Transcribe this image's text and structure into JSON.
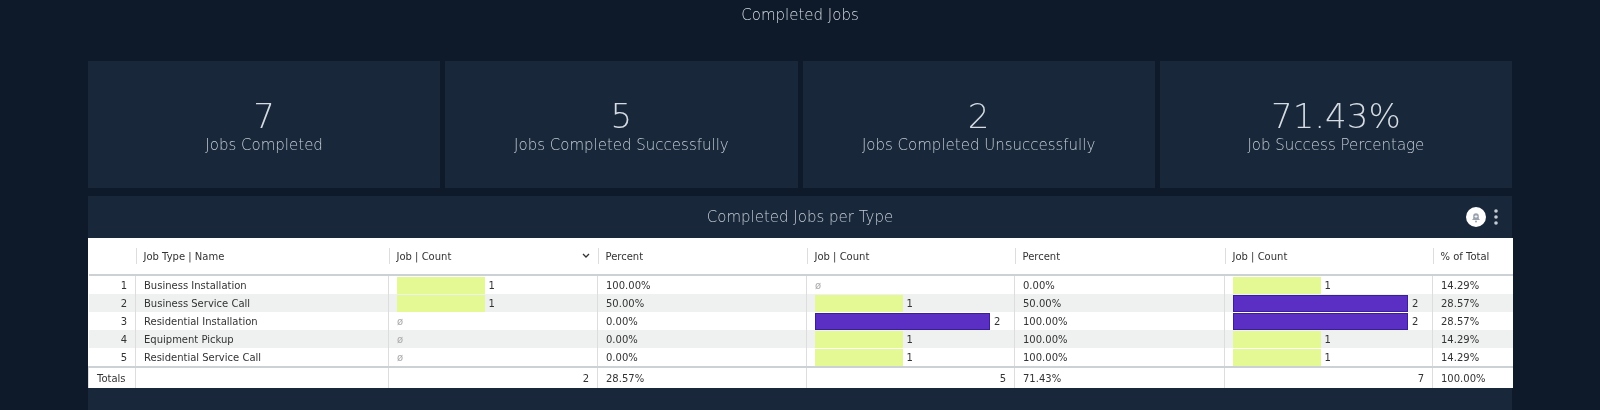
{
  "title": "Completed Jobs",
  "kpis": [
    {
      "value": "7",
      "label": "Jobs Completed"
    },
    {
      "value": "5",
      "label": "Jobs Completed Successfully"
    },
    {
      "value": "2",
      "label": "Jobs Completed Unsuccessfully"
    },
    {
      "value": "71.43%",
      "label": "Job Success Percentage"
    }
  ],
  "table_panel": {
    "title": "Completed Jobs per Type",
    "columns": [
      {
        "label": "Job Type | Name",
        "kind": "text",
        "sort_menu": false
      },
      {
        "label": "Job | Count",
        "kind": "bar",
        "sort_menu": true
      },
      {
        "label": "Percent",
        "kind": "text",
        "sort_menu": false
      },
      {
        "label": "Job | Count",
        "kind": "bar",
        "sort_menu": false
      },
      {
        "label": "Percent",
        "kind": "text",
        "sort_menu": false
      },
      {
        "label": "Job | Count",
        "kind": "bar",
        "sort_menu": false
      },
      {
        "label": "% of Total",
        "kind": "text",
        "sort_menu": false
      }
    ],
    "rows": [
      {
        "index": "1",
        "cells": [
          {
            "text": "Business Installation"
          },
          {
            "text": "1",
            "color": "#e4f993"
          },
          {
            "text": "100.00%"
          },
          {
            "text": "ø"
          },
          {
            "text": "0.00%"
          },
          {
            "text": "1",
            "color": "#e4f993"
          },
          {
            "text": "14.29%"
          }
        ]
      },
      {
        "index": "2",
        "cells": [
          {
            "text": "Business Service Call"
          },
          {
            "text": "1",
            "color": "#e4f993"
          },
          {
            "text": "50.00%"
          },
          {
            "text": "1",
            "color": "#e4f993"
          },
          {
            "text": "50.00%"
          },
          {
            "text": "2",
            "color": "#5b2fc4"
          },
          {
            "text": "28.57%"
          }
        ]
      },
      {
        "index": "3",
        "cells": [
          {
            "text": "Residential Installation"
          },
          {
            "text": "ø"
          },
          {
            "text": "0.00%"
          },
          {
            "text": "2",
            "color": "#5b2fc4"
          },
          {
            "text": "100.00%"
          },
          {
            "text": "2",
            "color": "#5b2fc4"
          },
          {
            "text": "28.57%"
          }
        ]
      },
      {
        "index": "4",
        "cells": [
          {
            "text": "Equipment Pickup"
          },
          {
            "text": "ø"
          },
          {
            "text": "0.00%"
          },
          {
            "text": "1",
            "color": "#e4f993"
          },
          {
            "text": "100.00%"
          },
          {
            "text": "1",
            "color": "#e4f993"
          },
          {
            "text": "14.29%"
          }
        ]
      },
      {
        "index": "5",
        "cells": [
          {
            "text": "Residential Service Call"
          },
          {
            "text": "ø"
          },
          {
            "text": "0.00%"
          },
          {
            "text": "1",
            "color": "#e4f993"
          },
          {
            "text": "100.00%"
          },
          {
            "text": "1",
            "color": "#e4f993"
          },
          {
            "text": "14.29%"
          }
        ]
      }
    ],
    "totals": {
      "label": "Totals",
      "cells": [
        "",
        "2",
        "28.57%",
        "5",
        "71.43%",
        "7",
        "100.00%"
      ]
    }
  }
}
